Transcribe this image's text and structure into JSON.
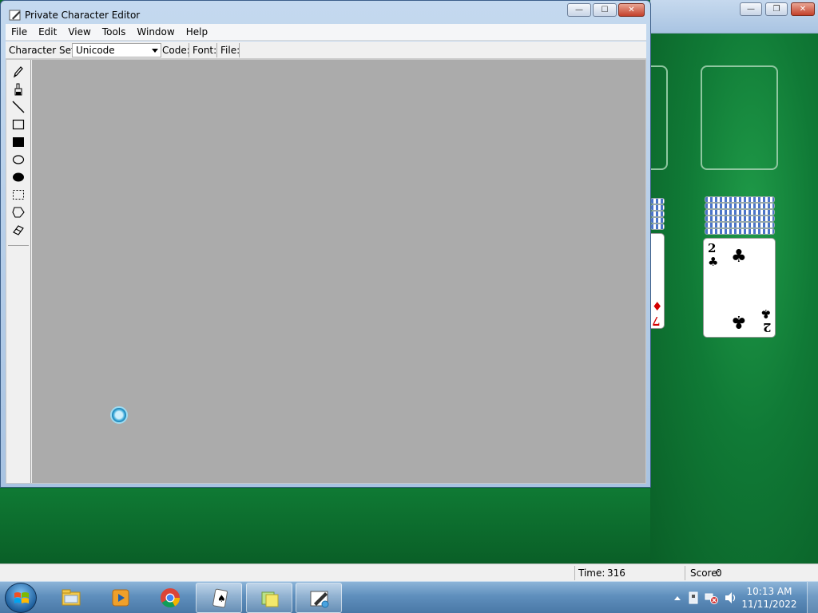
{
  "pce": {
    "title": "Private Character Editor",
    "menu": [
      "File",
      "Edit",
      "View",
      "Tools",
      "Window",
      "Help"
    ],
    "toolbar": {
      "charset_label": "Character Set:",
      "charset_value": "Unicode",
      "code_label": "Code:",
      "font_label": "Font:",
      "file_label": "File:"
    },
    "tools": [
      "pencil-icon",
      "brush-icon",
      "line-icon",
      "hollow-rectangle-icon",
      "filled-rectangle-icon",
      "hollow-ellipse-icon",
      "filled-ellipse-icon",
      "rectangular-selection-icon",
      "freeform-selection-icon",
      "eraser-icon"
    ]
  },
  "solitaire": {
    "status": {
      "time_label": "Time:",
      "time_value": "316",
      "score_label": "Score:",
      "score_value": "0"
    },
    "visible_cards": [
      {
        "rank": "2",
        "suit": "♣",
        "color": "#000000"
      },
      {
        "rank": "7",
        "suit": "♦",
        "color": "#d40000"
      }
    ],
    "felt_color": "#107a36"
  },
  "taskbar": {
    "apps": [
      "windows-explorer-icon",
      "media-player-icon",
      "chrome-icon",
      "solitaire-icon",
      "sticky-notes-icon",
      "private-character-editor-icon"
    ],
    "clock_time": "10:13 AM",
    "clock_date": "11/11/2022"
  }
}
